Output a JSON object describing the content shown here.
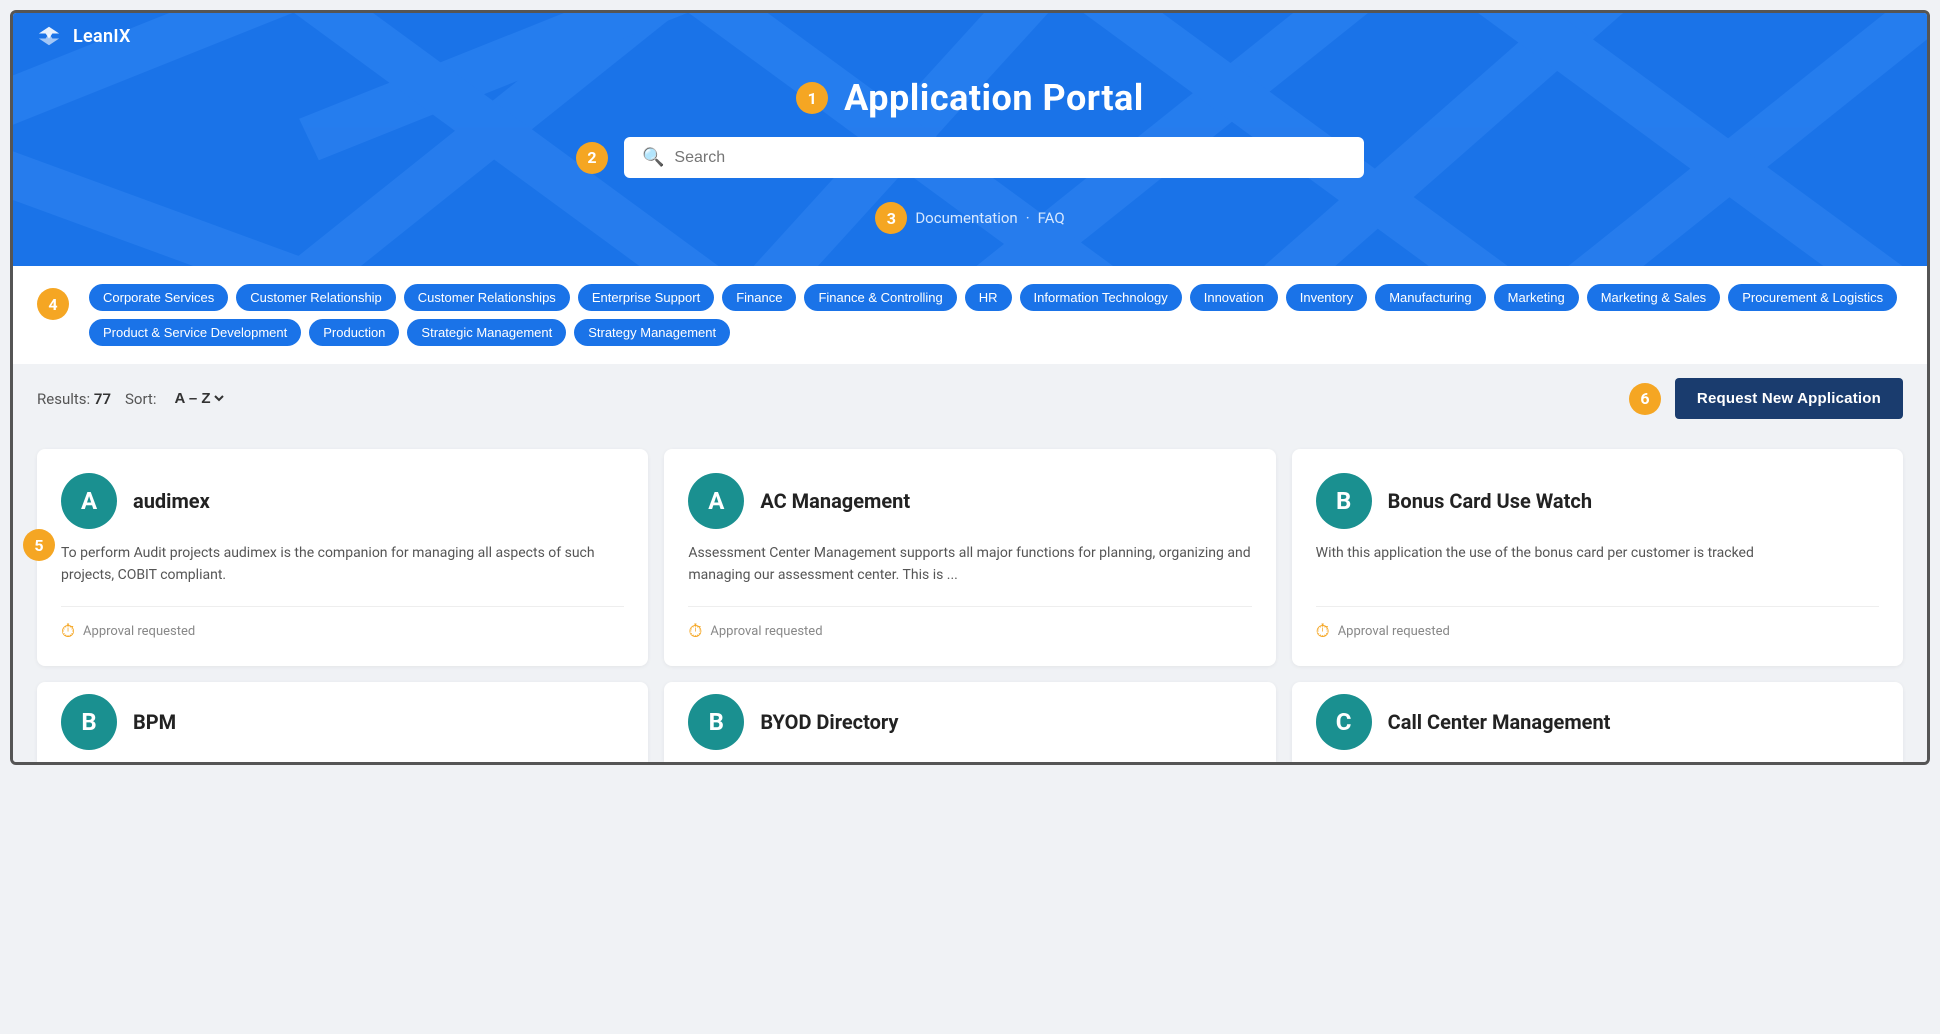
{
  "page": {
    "frame_title": "Application Portal"
  },
  "header": {
    "logo_text": "LeanIX",
    "title": "Application Portal",
    "title_badge": "1",
    "search_placeholder": "Search",
    "search_badge": "2",
    "nav_badge": "3",
    "nav_links": [
      {
        "label": "Documentation",
        "id": "doc"
      },
      {
        "label": "FAQ",
        "id": "faq"
      }
    ],
    "nav_separator": "·"
  },
  "filters": {
    "badge": "4",
    "chips": [
      "Corporate Services",
      "Customer Relationship",
      "Customer Relationships",
      "Enterprise Support",
      "Finance",
      "Finance & Controlling",
      "HR",
      "Information Technology",
      "Innovation",
      "Inventory",
      "Manufacturing",
      "Marketing",
      "Marketing & Sales",
      "Procurement & Logistics",
      "Product & Service Development",
      "Production",
      "Strategic Management",
      "Strategy Management"
    ]
  },
  "results": {
    "label": "Results:",
    "count": "77",
    "sort_label": "Sort:",
    "sort_value": "A – Z",
    "request_badge": "6",
    "request_btn_label": "Request New Application"
  },
  "cards": [
    {
      "letter": "A",
      "name": "audimex",
      "description": "To perform Audit projects audimex is the companion for managing all aspects of such projects, COBIT compliant.",
      "status": "Approval requested"
    },
    {
      "letter": "A",
      "name": "AC Management",
      "description": "Assessment Center Management supports all major functions for planning, organizing and managing our assessment center. This is ...",
      "status": "Approval requested"
    },
    {
      "letter": "B",
      "name": "Bonus Card Use Watch",
      "description": "With this application the use of the bonus card per customer is tracked",
      "status": "Approval requested"
    }
  ],
  "partial_cards": [
    {
      "letter": "B",
      "name": "BPM"
    },
    {
      "letter": "B",
      "name": "BYOD Directory"
    },
    {
      "letter": "C",
      "name": "Call Center Management"
    }
  ],
  "annotations": {
    "badge5": "5"
  },
  "colors": {
    "primary_blue": "#1a73e8",
    "dark_blue": "#1a3c6e",
    "teal": "#1a9090",
    "orange": "#f5a623"
  }
}
